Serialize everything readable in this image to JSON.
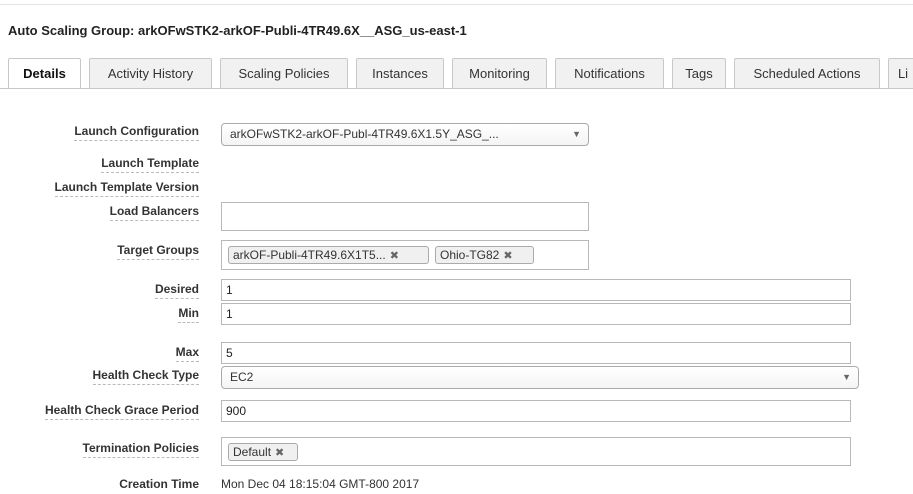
{
  "header": {
    "title": "Auto Scaling Group: arkOFwSTK2-arkOF-Publi-4TR49.6X__ASG_us-east-1"
  },
  "tabs": [
    {
      "label": "Details"
    },
    {
      "label": "Activity History"
    },
    {
      "label": "Scaling Policies"
    },
    {
      "label": "Instances"
    },
    {
      "label": "Monitoring"
    },
    {
      "label": "Notifications"
    },
    {
      "label": "Tags"
    },
    {
      "label": "Scheduled Actions"
    },
    {
      "label": "Li"
    }
  ],
  "details": {
    "launch_configuration": {
      "label": "Launch Configuration",
      "value": "arkOFwSTK2-arkOF-Publ-4TR49.6X1.5Y_ASG_..."
    },
    "launch_template": {
      "label": "Launch Template"
    },
    "launch_template_version": {
      "label": "Launch Template Version"
    },
    "load_balancers": {
      "label": "Load Balancers",
      "value": ""
    },
    "target_groups": {
      "label": "Target Groups",
      "tags": [
        "arkOF-Publi-4TR49.6X1T5...",
        "Ohio-TG82"
      ]
    },
    "desired": {
      "label": "Desired",
      "value": "1"
    },
    "min": {
      "label": "Min",
      "value": "1"
    },
    "max": {
      "label": "Max",
      "value": "5"
    },
    "health_check_type": {
      "label": "Health Check Type",
      "value": "EC2"
    },
    "health_check_grace_period": {
      "label": "Health Check Grace Period",
      "value": "900"
    },
    "termination_policies": {
      "label": "Termination Policies",
      "tags": [
        "Default"
      ]
    },
    "creation_time": {
      "label": "Creation Time",
      "value": "Mon Dec 04 18:15:04 GMT-800 2017"
    }
  },
  "icons": {
    "remove": "close-icon",
    "dropdown": "chevron-down-icon"
  }
}
